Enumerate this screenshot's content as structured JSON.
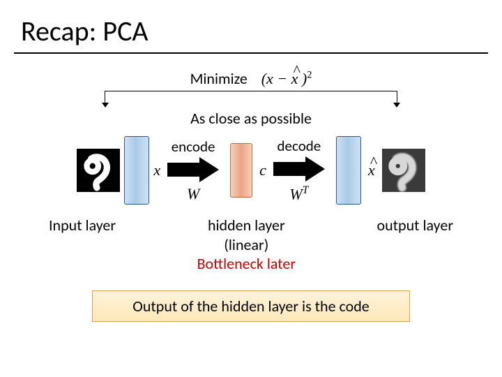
{
  "title": "Recap: PCA",
  "minimize_label": "Minimize",
  "minimize_expr_left": "(x − ",
  "minimize_expr_xhat": "x",
  "minimize_expr_right": " )",
  "minimize_expr_pow": "2",
  "as_close": "As close as possible",
  "encode": "encode",
  "decode": "decode",
  "x_label": "x",
  "c_label": "c",
  "xhat_label": "x",
  "W_label": "W",
  "WT_label_base": "W",
  "WT_label_sup": "T",
  "input_layer": "Input layer",
  "hidden_line1": "hidden layer",
  "hidden_line2": "(linear)",
  "hidden_line3": "Bottleneck later",
  "output_layer": "output layer",
  "code_box": "Output of the hidden layer is the code"
}
